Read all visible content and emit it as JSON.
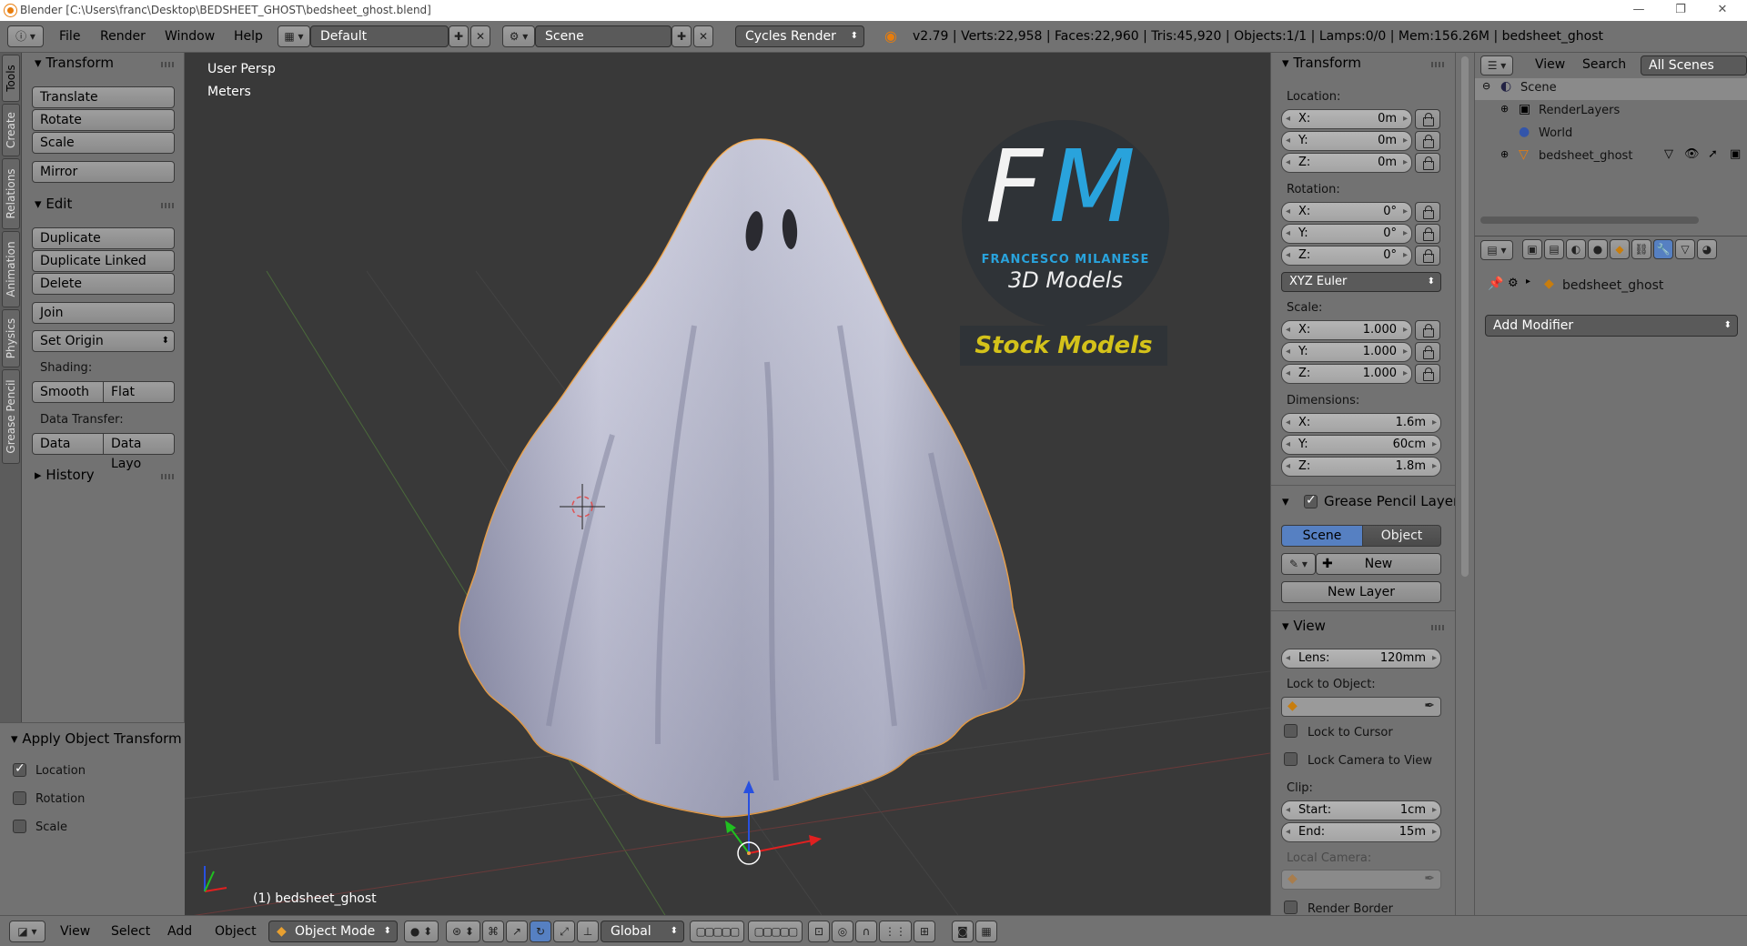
{
  "window": {
    "title": "Blender [C:\\Users\\franc\\Desktop\\BEDSHEET_GHOST\\bedsheet_ghost.blend]",
    "controls": [
      "—",
      "❐",
      "✕"
    ]
  },
  "header": {
    "menus": [
      "File",
      "Render",
      "Window",
      "Help"
    ],
    "layout": "Default",
    "scene": "Scene",
    "engine": "Cycles Render",
    "stats": "v2.79 | Verts:22,958 | Faces:22,960 | Tris:45,920 | Objects:1/1 | Lamps:0/0 | Mem:156.26M | bedsheet_ghost"
  },
  "left_tabs": [
    "Tools",
    "Create",
    "Relations",
    "Animation",
    "Physics",
    "Grease Pencil"
  ],
  "toolshelf": {
    "transform": {
      "title": "Transform",
      "buttons": [
        "Translate",
        "Rotate",
        "Scale",
        "Mirror"
      ]
    },
    "edit": {
      "title": "Edit",
      "buttons": [
        "Duplicate",
        "Duplicate Linked",
        "Delete",
        "Join"
      ],
      "set_origin": "Set Origin",
      "shading_label": "Shading:",
      "smooth": "Smooth",
      "flat": "Flat",
      "data_transfer_label": "Data Transfer:",
      "data": "Data",
      "data_layo": "Data Layo"
    },
    "history": {
      "title": "History"
    }
  },
  "operator": {
    "title": "Apply Object Transform",
    "options": [
      {
        "label": "Location",
        "checked": true
      },
      {
        "label": "Rotation",
        "checked": false
      },
      {
        "label": "Scale",
        "checked": false
      }
    ]
  },
  "viewport": {
    "view_name": "User Persp",
    "units": "Meters",
    "object_label": "(1) bedsheet_ghost",
    "logo": {
      "letters_f": "F",
      "letters_m": "M",
      "brand": "FRANCESCO MILANESE",
      "subtitle": "3D Models",
      "stock": "Stock Models"
    }
  },
  "npanel": {
    "transform_title": "Transform",
    "location_label": "Location:",
    "location": {
      "x": "0m",
      "y": "0m",
      "z": "0m"
    },
    "rotation_label": "Rotation:",
    "rotation": {
      "x": "0°",
      "y": "0°",
      "z": "0°"
    },
    "rotation_mode": "XYZ Euler",
    "scale_label": "Scale:",
    "scale": {
      "x": "1.000",
      "y": "1.000",
      "z": "1.000"
    },
    "dimensions_label": "Dimensions:",
    "dimensions": {
      "x": "1.6m",
      "y": "60cm",
      "z": "1.8m"
    },
    "axis": {
      "x": "X:",
      "y": "Y:",
      "z": "Z:"
    },
    "grease_title": "Grease Pencil Layer",
    "grease_scene": "Scene",
    "grease_object": "Object",
    "grease_new": "New",
    "grease_new_layer": "New Layer",
    "view_title": "View",
    "lens_label": "Lens:",
    "lens": "120mm",
    "lock_object_label": "Lock to Object:",
    "lock_cursor": "Lock to Cursor",
    "lock_camera": "Lock Camera to View",
    "clip_label": "Clip:",
    "clip_start_label": "Start:",
    "clip_start": "1cm",
    "clip_end_label": "End:",
    "clip_end": "15m",
    "local_camera_label": "Local Camera:",
    "render_border": "Render Border"
  },
  "outliner": {
    "menu_view": "View",
    "menu_search": "Search",
    "display_mode": "All Scenes",
    "items": [
      "Scene",
      "RenderLayers",
      "World",
      "bedsheet_ghost"
    ]
  },
  "properties": {
    "object_name": "bedsheet_ghost",
    "add_modifier": "Add Modifier"
  },
  "bottombar": {
    "menus": [
      "View",
      "Select",
      "Add",
      "Object"
    ],
    "mode": "Object Mode",
    "orientation": "Global"
  },
  "colors": {
    "panel_bg": "#727272",
    "viewport_bg": "#393939",
    "accent_blue": "#5680c2",
    "logo_blue": "#29a3dc",
    "stock_yellow": "#d4c21a",
    "selection_orange": "#f0a040"
  }
}
